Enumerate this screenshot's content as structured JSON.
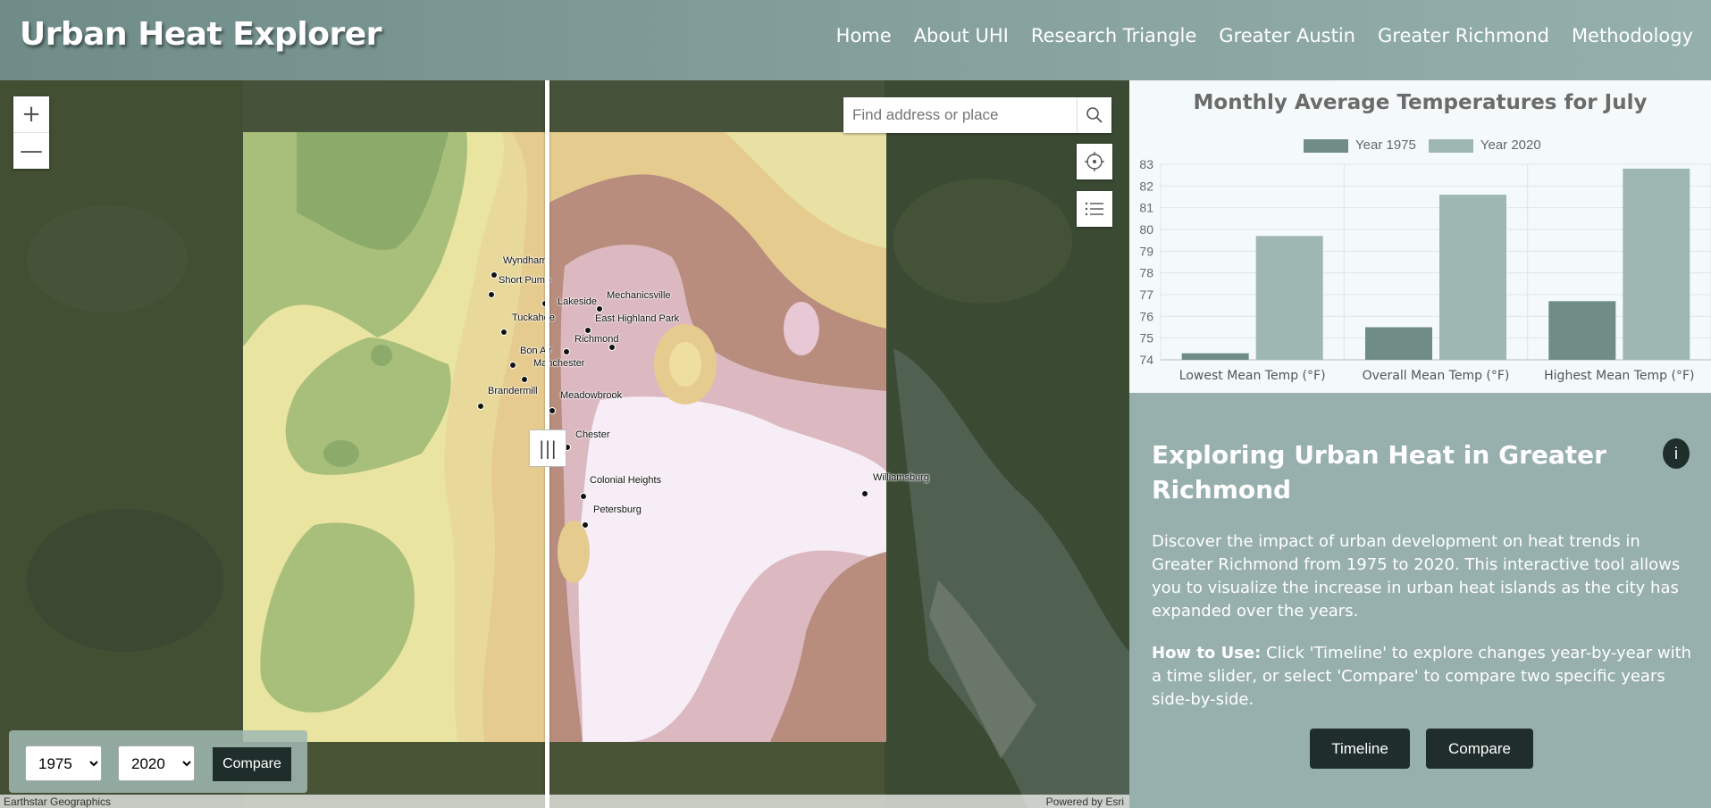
{
  "app": {
    "title": "Urban Heat Explorer"
  },
  "nav": [
    "Home",
    "About UHI",
    "Research Triangle",
    "Greater Austin",
    "Greater Richmond",
    "Methodology"
  ],
  "map": {
    "zoom_in": "+",
    "zoom_out": "—",
    "search_placeholder": "Find address or place",
    "swipe_handle": "|||",
    "attribution_left": "Earthstar Geographics",
    "attribution_right": "Powered by Esri",
    "places": [
      "Wyndham",
      "Short Pump",
      "Lakeside",
      "Mechanicsville",
      "Tuckahoe",
      "East Highland Park",
      "Richmond",
      "Bon Air",
      "Manchester",
      "Brandermill",
      "Meadowbrook",
      "Chester",
      "Colonial Heights",
      "Petersburg",
      "Williamsburg"
    ],
    "year_left_options": [
      "1975"
    ],
    "year_left": "1975",
    "year_right_options": [
      "2020"
    ],
    "year_right": "2020",
    "compare_label": "Compare"
  },
  "chart_data": {
    "type": "bar",
    "title": "Monthly Average Temperatures for July",
    "categories": [
      "Lowest Mean Temp (°F)",
      "Overall Mean Temp (°F)",
      "Highest Mean Temp (°F)"
    ],
    "series": [
      {
        "name": "Year 1975",
        "color": "#6f8c87",
        "values": [
          74.3,
          75.5,
          76.7
        ]
      },
      {
        "name": "Year 2020",
        "color": "#9fb7b3",
        "values": [
          79.7,
          81.6,
          82.8
        ]
      }
    ],
    "ylim": [
      74,
      83
    ],
    "yticks": [
      "74",
      "75",
      "76",
      "77",
      "78",
      "79",
      "80",
      "81",
      "82",
      "83"
    ],
    "grid": true,
    "legend": "top"
  },
  "info": {
    "heading": "Exploring Urban Heat in Greater Richmond",
    "info_button": "i",
    "intro": "Discover the impact of urban development on heat trends in Greater Richmond from 1975 to 2020. This interactive tool allows you to visualize the increase in urban heat islands as the city has expanded over the years.",
    "howto_label": "How to Use:",
    "howto_text": " Click 'Timeline' to explore changes year-by-year with a time slider, or select 'Compare' to compare two specific years side-by-side.",
    "timeline_button": "Timeline",
    "compare_button": "Compare"
  },
  "colors": {
    "accent": "#1f2e2b",
    "header": "#7d9894",
    "panel": "#97b0ad"
  }
}
